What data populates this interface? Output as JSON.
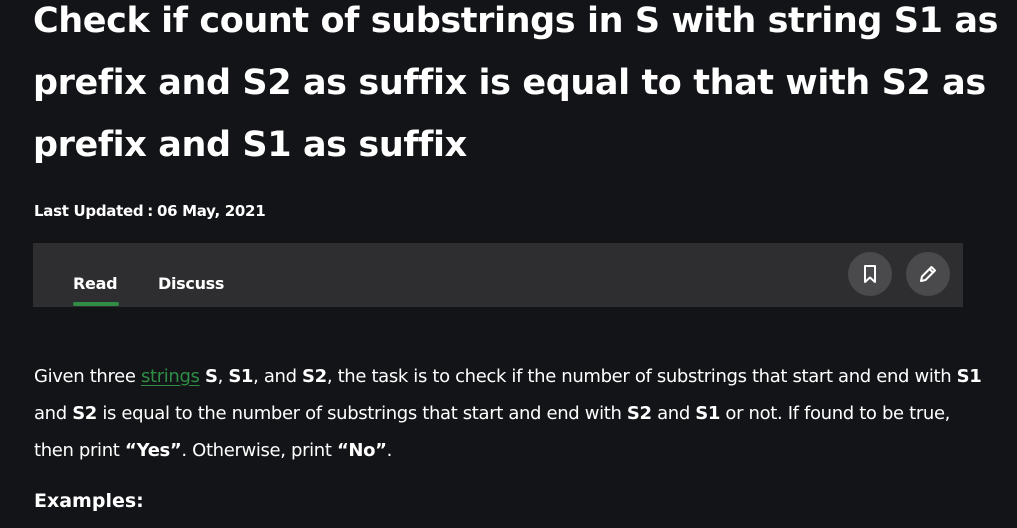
{
  "article": {
    "title": "Check if count of substrings in S with string S1 as prefix and S2 as suffix is equal to that with S2 as prefix and S1 as suffix",
    "last_updated_label": "Last Updated",
    "last_updated_sep": ":",
    "last_updated_date": "06 May, 2021"
  },
  "tabs": {
    "read": "Read",
    "discuss": "Discuss",
    "active": "Read"
  },
  "toolbar": {
    "bookmark_icon": "bookmark-icon",
    "edit_icon": "pencil-icon"
  },
  "content": {
    "p1": "Given three ",
    "link": "strings",
    "p2": " ",
    "b1": "S",
    "p3": ", ",
    "b2": "S1",
    "p4": ", and ",
    "b3": "S2",
    "p5": ", the task is to check if the number of substrings that start and end with ",
    "b4": "S1",
    "p6": " and ",
    "b5": "S2",
    "p7": " is equal to the number of substrings that start and end with ",
    "b6": "S2",
    "p8": " and ",
    "b7": "S1",
    "p9": " or not. If found to be true, then print ",
    "b8": "“Yes”",
    "p10": ". Otherwise, print ",
    "b9": "“No”",
    "p11": ".",
    "examples_heading": "Examples:"
  },
  "colors": {
    "background": "#131417",
    "tabbar": "#2e2e30",
    "accent_green": "#2f8d46",
    "icon_button": "#4a4a4c",
    "text": "#ffffff"
  }
}
